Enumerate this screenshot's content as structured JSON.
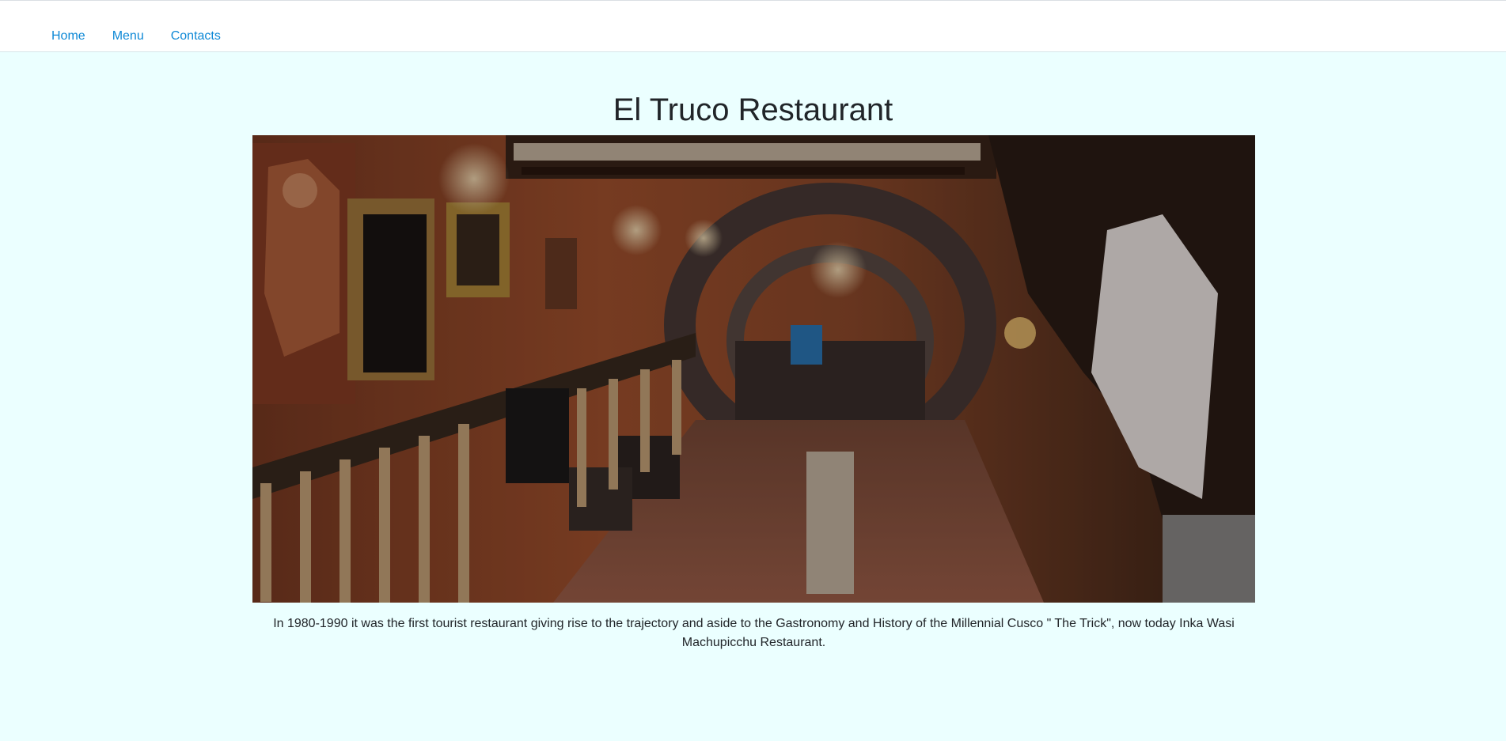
{
  "nav": {
    "items": [
      {
        "label": "Home"
      },
      {
        "label": "Menu"
      },
      {
        "label": "Contacts"
      }
    ]
  },
  "main": {
    "title": "El Truco Restaurant",
    "caption": "In 1980-1990 it was the first tourist restaurant giving rise to the trajectory and aside to the Gastronomy and History of the Millennial Cusco \" The Trick\", now today Inka Wasi Machupicchu Restaurant."
  },
  "colors": {
    "background": "#ebffff",
    "link": "#0d88d6",
    "text": "#212529"
  }
}
